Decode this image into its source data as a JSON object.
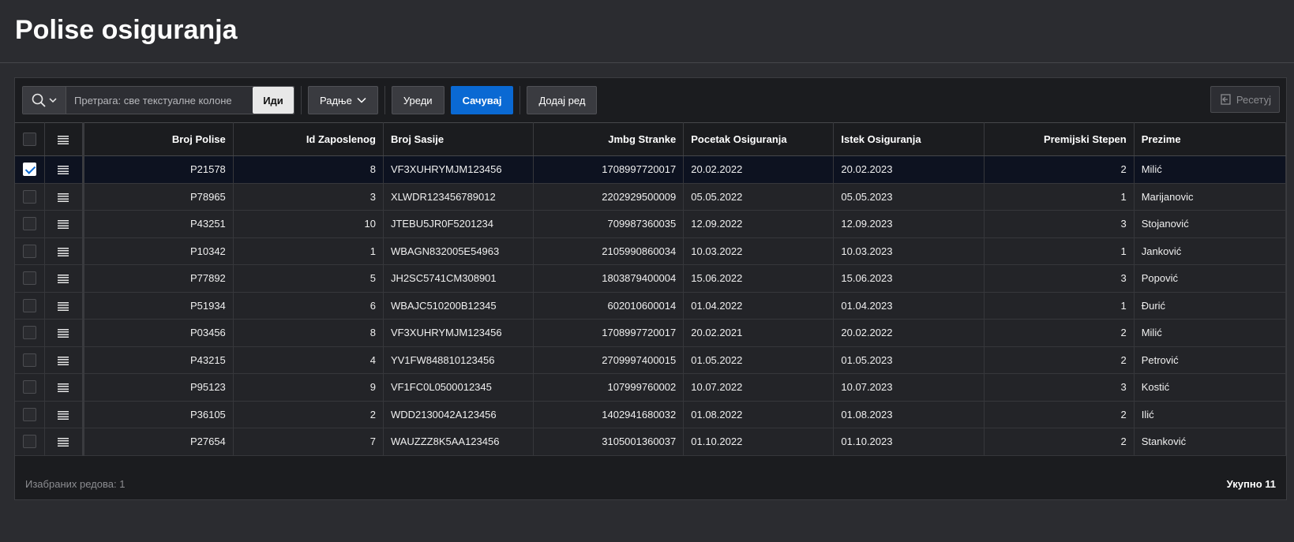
{
  "page": {
    "title": "Polise osiguranja"
  },
  "toolbar": {
    "search_placeholder": "Претрага: све текстуалне колоне",
    "go_label": "Иди",
    "actions_label": "Радње",
    "edit_label": "Уреди",
    "save_label": "Сачувај",
    "add_row_label": "Додај ред",
    "reset_label": "Ресетуј"
  },
  "table": {
    "columns": [
      "Broj Polise",
      "Id Zaposlenog",
      "Broj Sasije",
      "Jmbg Stranke",
      "Pocetak Osiguranja",
      "Istek Osiguranja",
      "Premijski Stepen",
      "Prezime"
    ],
    "rows": [
      {
        "selected": true,
        "cells": [
          "P21578",
          "8",
          "VF3XUHRYMJM123456",
          "1708997720017",
          "20.02.2022",
          "20.02.2023",
          "2",
          "Milić"
        ]
      },
      {
        "selected": false,
        "cells": [
          "P78965",
          "3",
          "XLWDR123456789012",
          "2202929500009",
          "05.05.2022",
          "05.05.2023",
          "1",
          "Marijanovic"
        ]
      },
      {
        "selected": false,
        "cells": [
          "P43251",
          "10",
          "JTEBU5JR0F5201234",
          "709987360035",
          "12.09.2022",
          "12.09.2023",
          "3",
          "Stojanović"
        ]
      },
      {
        "selected": false,
        "cells": [
          "P10342",
          "1",
          "WBAGN832005E54963",
          "2105990860034",
          "10.03.2022",
          "10.03.2023",
          "1",
          "Janković"
        ]
      },
      {
        "selected": false,
        "cells": [
          "P77892",
          "5",
          "JH2SC5741CM308901",
          "1803879400004",
          "15.06.2022",
          "15.06.2023",
          "3",
          "Popović"
        ]
      },
      {
        "selected": false,
        "cells": [
          "P51934",
          "6",
          "WBAJC510200B12345",
          "602010600014",
          "01.04.2022",
          "01.04.2023",
          "1",
          "Đurić"
        ]
      },
      {
        "selected": false,
        "cells": [
          "P03456",
          "8",
          "VF3XUHRYMJM123456",
          "1708997720017",
          "20.02.2021",
          "20.02.2022",
          "2",
          "Milić"
        ]
      },
      {
        "selected": false,
        "cells": [
          "P43215",
          "4",
          "YV1FW848810123456",
          "2709997400015",
          "01.05.2022",
          "01.05.2023",
          "2",
          "Petrović"
        ]
      },
      {
        "selected": false,
        "cells": [
          "P95123",
          "9",
          "VF1FC0L0500012345",
          "107999760002",
          "10.07.2022",
          "10.07.2023",
          "3",
          "Kostić"
        ]
      },
      {
        "selected": false,
        "cells": [
          "P36105",
          "2",
          "WDD2130042A123456",
          "1402941680032",
          "01.08.2022",
          "01.08.2023",
          "2",
          "Ilić"
        ]
      },
      {
        "selected": false,
        "cells": [
          "P27654",
          "7",
          "WAUZZZ8K5AA123456",
          "3105001360037",
          "01.10.2022",
          "01.10.2023",
          "2",
          "Stanković"
        ]
      }
    ]
  },
  "footer": {
    "selected_rows": "Изабраних редова: 1",
    "total": "Укупно 11"
  },
  "icons": {
    "search": "search-icon",
    "chevron": "chevron-down-icon",
    "row_actions": "row-actions-icon",
    "reset": "reset-icon"
  },
  "colors": {
    "accent": "#0a69d3",
    "background": "#2b2c30",
    "region": "#1b1c1f"
  }
}
